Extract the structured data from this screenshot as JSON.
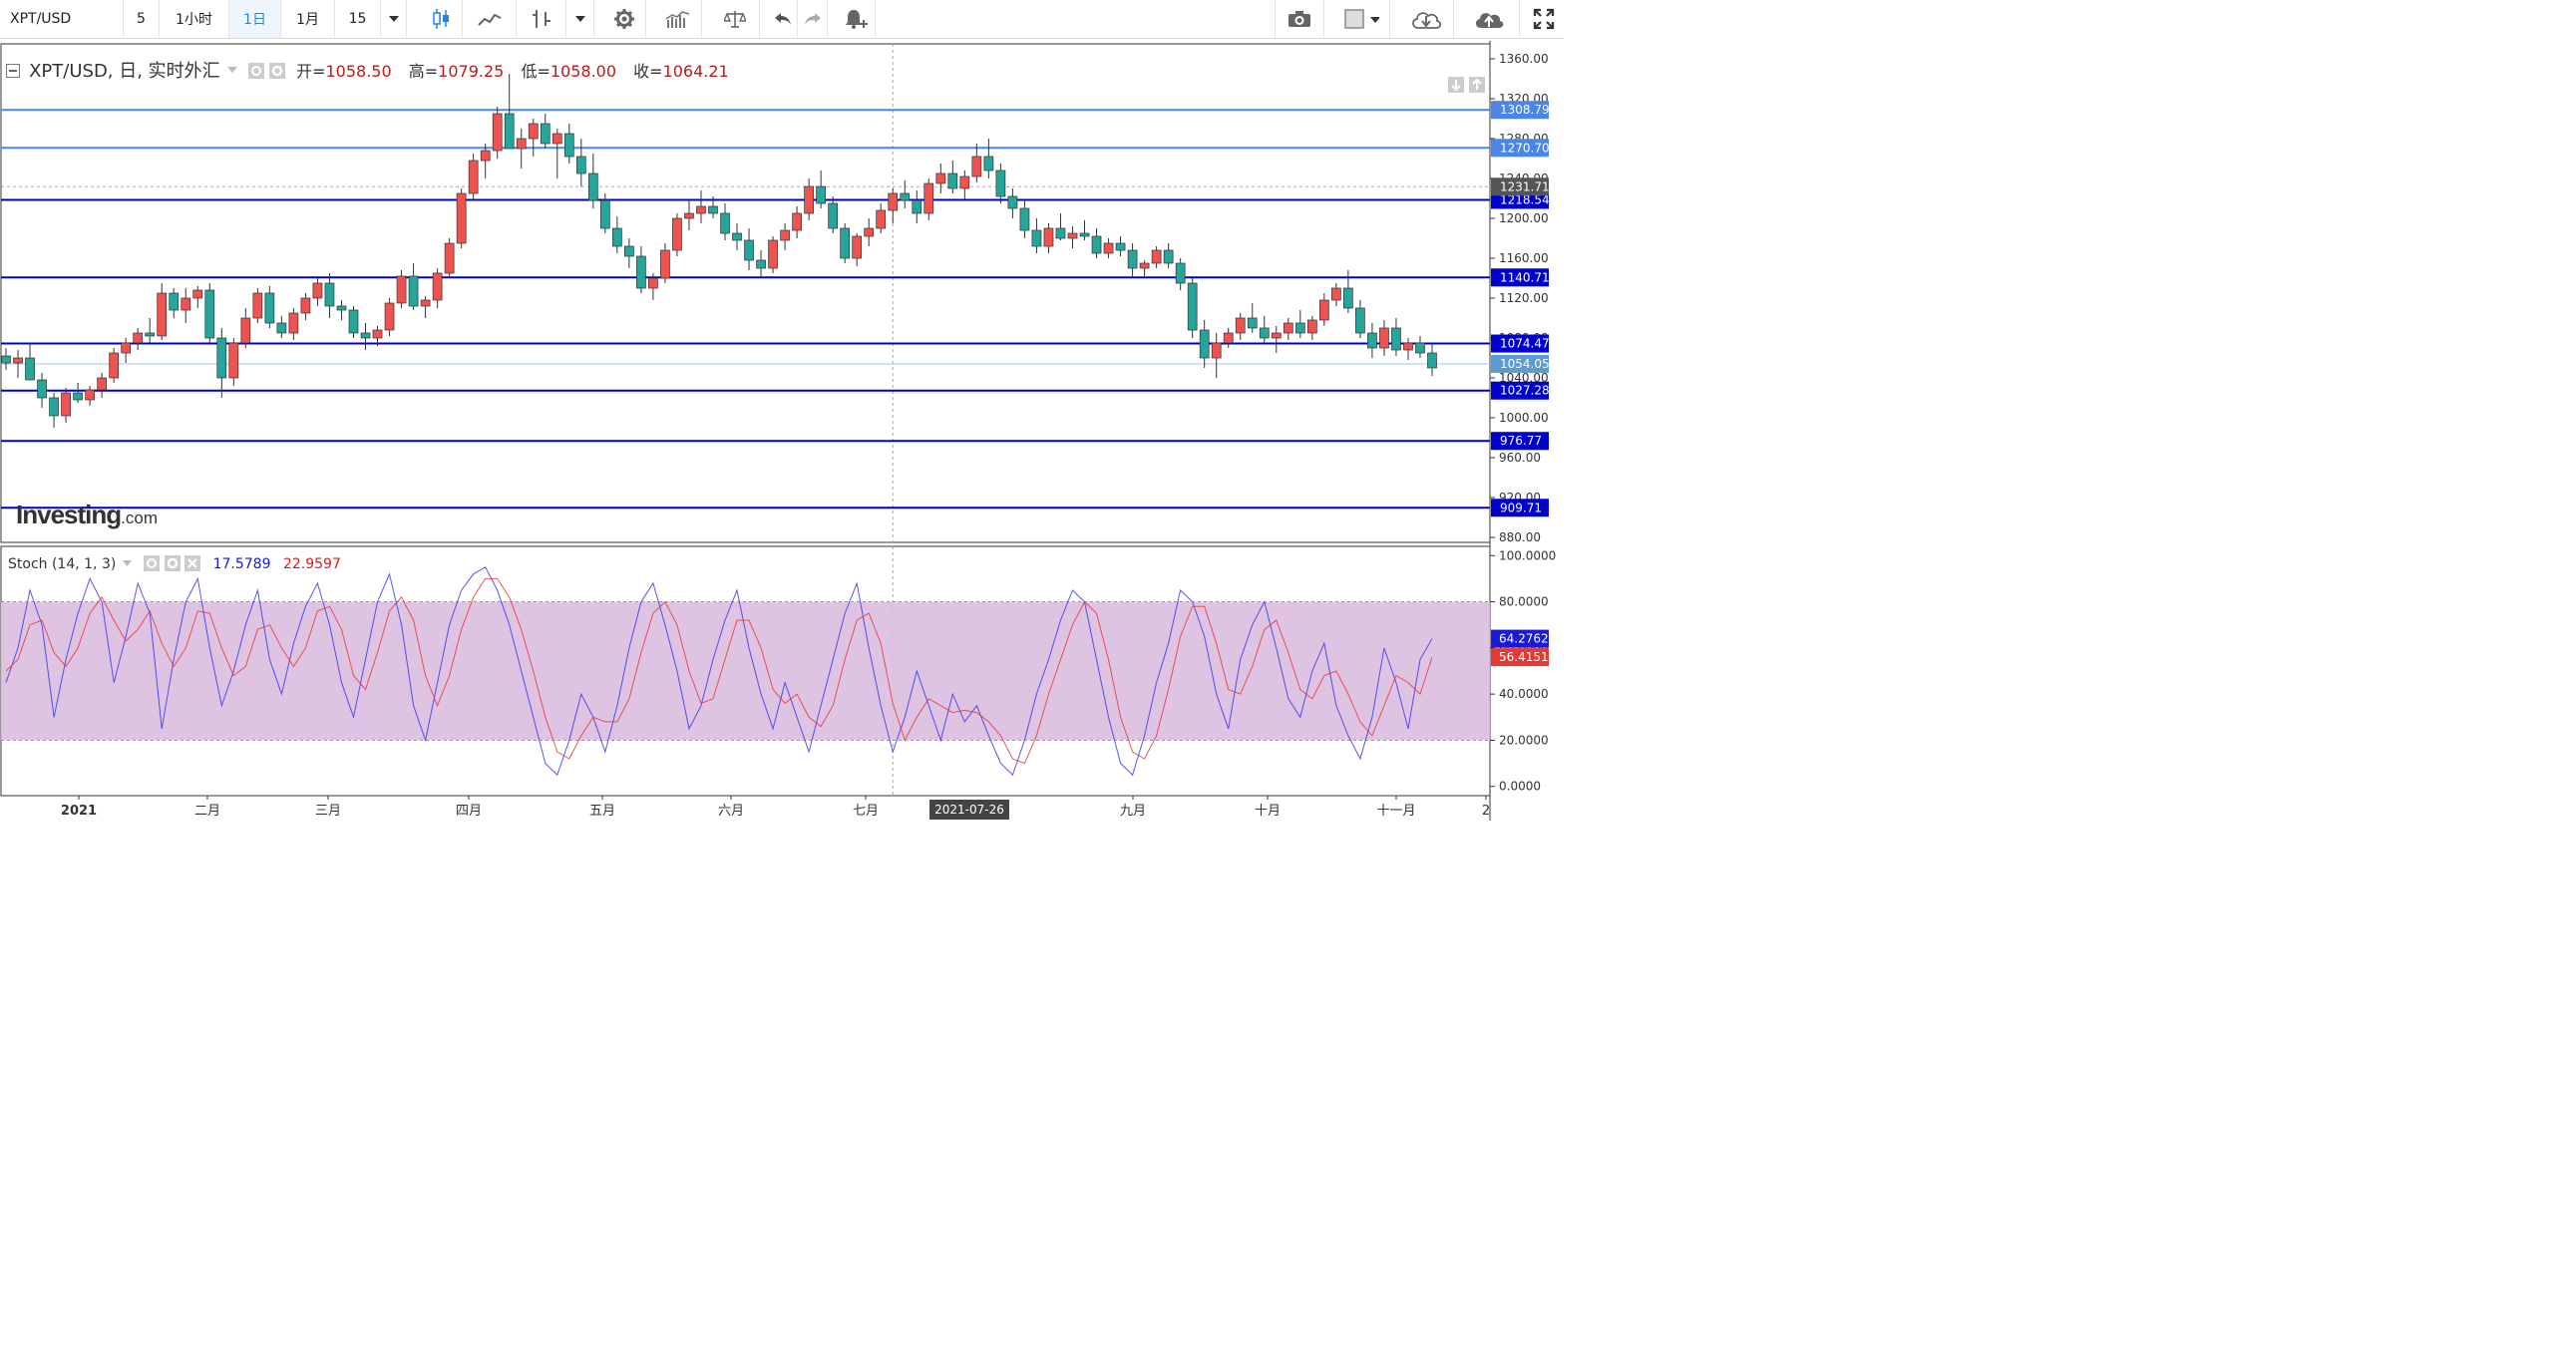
{
  "toolbar": {
    "symbol": "XPT/USD",
    "intervals": [
      "5",
      "1小时",
      "1日",
      "1月",
      "15"
    ],
    "active_interval": "1日"
  },
  "legend": {
    "title": "XPT/USD, 日, 实时外汇",
    "open_label": "开=",
    "open": "1058.50",
    "high_label": "高=",
    "high": "1079.25",
    "low_label": "低=",
    "low": "1058.00",
    "close_label": "收=",
    "close": "1064.21"
  },
  "stoch_legend": {
    "title": "Stoch (14, 1, 3)",
    "k_value": "17.5789",
    "d_value": "22.9597"
  },
  "watermark": {
    "brand": "Investing",
    "suffix": ".com"
  },
  "colors": {
    "up": "#ef5350",
    "down": "#26a69a",
    "level": "#0000cc",
    "level_light": "#4a86e8",
    "stoch_k": "#3a3ae8",
    "stoch_d": "#e83a3a",
    "stoch_band": "#dcbce0"
  },
  "chart_data": [
    {
      "type": "candlestick",
      "title": "XPT/USD",
      "y_ticks": [
        "880.00",
        "920.00",
        "960.00",
        "1000.00",
        "1040.00",
        "1080.00",
        "1120.00",
        "1160.00",
        "1200.00",
        "1240.00",
        "1280.00",
        "1320.00",
        "1360.00"
      ],
      "ylim": [
        875,
        1375
      ],
      "x_ticks": [
        "2021",
        "二月",
        "三月",
        "四月",
        "五月",
        "六月",
        "七月",
        "2021-07-26",
        "九月",
        "十月",
        "十一月",
        "2"
      ],
      "crosshair_date": "2021-07-26",
      "horizontal_levels": [
        1308.79,
        1270.7,
        1218.54,
        1140.71,
        1074.47,
        1027.28,
        976.77,
        909.71
      ],
      "level_labels": [
        "1308.79",
        "1270.70",
        "1218.54",
        "1140.71",
        "1074.47",
        "1027.28",
        "976.77",
        "909.71"
      ],
      "last_price": 1054.05,
      "last_price_label": "1054.05",
      "crosshair_price": 1231.71,
      "crosshair_price_label": "1231.71",
      "candles": [
        [
          1062,
          1070,
          1048,
          1055
        ],
        [
          1055,
          1068,
          1040,
          1060
        ],
        [
          1060,
          1075,
          1050,
          1038
        ],
        [
          1038,
          1045,
          1010,
          1020
        ],
        [
          1020,
          1025,
          990,
          1002
        ],
        [
          1002,
          1030,
          995,
          1025
        ],
        [
          1025,
          1035,
          1015,
          1018
        ],
        [
          1018,
          1032,
          1012,
          1028
        ],
        [
          1028,
          1045,
          1020,
          1040
        ],
        [
          1040,
          1070,
          1035,
          1065
        ],
        [
          1065,
          1080,
          1055,
          1075
        ],
        [
          1075,
          1090,
          1068,
          1085
        ],
        [
          1085,
          1100,
          1075,
          1082
        ],
        [
          1082,
          1135,
          1078,
          1125
        ],
        [
          1125,
          1130,
          1100,
          1108
        ],
        [
          1108,
          1130,
          1095,
          1120
        ],
        [
          1120,
          1132,
          1110,
          1128
        ],
        [
          1128,
          1135,
          1075,
          1080
        ],
        [
          1080,
          1090,
          1020,
          1040
        ],
        [
          1040,
          1080,
          1032,
          1075
        ],
        [
          1075,
          1110,
          1070,
          1100
        ],
        [
          1100,
          1130,
          1095,
          1125
        ],
        [
          1125,
          1132,
          1090,
          1095
        ],
        [
          1095,
          1102,
          1080,
          1085
        ],
        [
          1085,
          1110,
          1078,
          1105
        ],
        [
          1105,
          1125,
          1098,
          1120
        ],
        [
          1120,
          1140,
          1112,
          1135
        ],
        [
          1135,
          1145,
          1100,
          1112
        ],
        [
          1112,
          1118,
          1098,
          1108
        ],
        [
          1108,
          1112,
          1080,
          1085
        ],
        [
          1085,
          1095,
          1068,
          1080
        ],
        [
          1080,
          1092,
          1072,
          1088
        ],
        [
          1088,
          1120,
          1082,
          1115
        ],
        [
          1115,
          1148,
          1110,
          1142
        ],
        [
          1142,
          1155,
          1108,
          1112
        ],
        [
          1112,
          1122,
          1100,
          1118
        ],
        [
          1118,
          1150,
          1110,
          1145
        ],
        [
          1145,
          1180,
          1140,
          1175
        ],
        [
          1175,
          1230,
          1170,
          1225
        ],
        [
          1225,
          1265,
          1218,
          1258
        ],
        [
          1258,
          1275,
          1240,
          1268
        ],
        [
          1268,
          1312,
          1260,
          1305
        ],
        [
          1305,
          1345,
          1290,
          1270
        ],
        [
          1270,
          1290,
          1250,
          1280
        ],
        [
          1280,
          1300,
          1262,
          1295
        ],
        [
          1295,
          1305,
          1270,
          1275
        ],
        [
          1275,
          1290,
          1240,
          1285
        ],
        [
          1285,
          1295,
          1255,
          1262
        ],
        [
          1262,
          1280,
          1232,
          1245
        ],
        [
          1245,
          1265,
          1210,
          1218
        ],
        [
          1218,
          1225,
          1185,
          1190
        ],
        [
          1190,
          1202,
          1165,
          1172
        ],
        [
          1172,
          1180,
          1150,
          1162
        ],
        [
          1162,
          1172,
          1125,
          1130
        ],
        [
          1130,
          1145,
          1118,
          1140
        ],
        [
          1140,
          1175,
          1135,
          1168
        ],
        [
          1168,
          1205,
          1162,
          1200
        ],
        [
          1200,
          1218,
          1188,
          1205
        ],
        [
          1205,
          1228,
          1195,
          1212
        ],
        [
          1212,
          1222,
          1200,
          1205
        ],
        [
          1205,
          1215,
          1178,
          1185
        ],
        [
          1185,
          1195,
          1168,
          1178
        ],
        [
          1178,
          1190,
          1148,
          1158
        ],
        [
          1158,
          1168,
          1140,
          1150
        ],
        [
          1150,
          1182,
          1145,
          1178
        ],
        [
          1178,
          1195,
          1168,
          1188
        ],
        [
          1188,
          1212,
          1180,
          1205
        ],
        [
          1205,
          1240,
          1198,
          1232
        ],
        [
          1232,
          1248,
          1210,
          1215
        ],
        [
          1215,
          1222,
          1185,
          1190
        ],
        [
          1190,
          1195,
          1155,
          1160
        ],
        [
          1160,
          1185,
          1152,
          1182
        ],
        [
          1182,
          1200,
          1172,
          1190
        ],
        [
          1190,
          1215,
          1185,
          1208
        ],
        [
          1208,
          1230,
          1195,
          1225
        ],
        [
          1225,
          1238,
          1210,
          1218
        ],
        [
          1218,
          1228,
          1195,
          1205
        ],
        [
          1205,
          1240,
          1198,
          1235
        ],
        [
          1235,
          1255,
          1225,
          1245
        ],
        [
          1245,
          1258,
          1225,
          1230
        ],
        [
          1230,
          1248,
          1218,
          1242
        ],
        [
          1242,
          1275,
          1236,
          1262
        ],
        [
          1262,
          1280,
          1240,
          1248
        ],
        [
          1248,
          1255,
          1215,
          1222
        ],
        [
          1222,
          1230,
          1200,
          1210
        ],
        [
          1210,
          1218,
          1180,
          1188
        ],
        [
          1188,
          1200,
          1165,
          1172
        ],
        [
          1172,
          1195,
          1165,
          1190
        ],
        [
          1190,
          1205,
          1178,
          1180
        ],
        [
          1180,
          1192,
          1170,
          1185
        ],
        [
          1185,
          1198,
          1178,
          1182
        ],
        [
          1182,
          1190,
          1160,
          1165
        ],
        [
          1165,
          1180,
          1160,
          1175
        ],
        [
          1175,
          1182,
          1162,
          1168
        ],
        [
          1168,
          1175,
          1140,
          1150
        ],
        [
          1150,
          1158,
          1142,
          1155
        ],
        [
          1155,
          1172,
          1150,
          1168
        ],
        [
          1168,
          1175,
          1150,
          1155
        ],
        [
          1155,
          1160,
          1128,
          1135
        ],
        [
          1135,
          1140,
          1080,
          1088
        ],
        [
          1088,
          1098,
          1050,
          1060
        ],
        [
          1060,
          1085,
          1040,
          1075
        ],
        [
          1075,
          1090,
          1070,
          1085
        ],
        [
          1085,
          1105,
          1078,
          1100
        ],
        [
          1100,
          1115,
          1085,
          1090
        ],
        [
          1090,
          1102,
          1075,
          1080
        ],
        [
          1080,
          1092,
          1065,
          1085
        ],
        [
          1085,
          1100,
          1078,
          1095
        ],
        [
          1095,
          1108,
          1080,
          1085
        ],
        [
          1085,
          1102,
          1078,
          1098
        ],
        [
          1098,
          1125,
          1092,
          1118
        ],
        [
          1118,
          1135,
          1112,
          1130
        ],
        [
          1130,
          1148,
          1105,
          1110
        ],
        [
          1110,
          1118,
          1080,
          1085
        ],
        [
          1085,
          1095,
          1060,
          1070
        ],
        [
          1070,
          1098,
          1062,
          1090
        ],
        [
          1090,
          1100,
          1062,
          1068
        ],
        [
          1068,
          1080,
          1058,
          1075
        ],
        [
          1075,
          1082,
          1060,
          1065
        ],
        [
          1065,
          1075,
          1042,
          1050
        ]
      ]
    },
    {
      "type": "line",
      "title": "Stoch (14, 1, 3)",
      "y_ticks": [
        "0.0000",
        "20.0000",
        "40.0000",
        "60.0000",
        "80.0000",
        "100.0000"
      ],
      "ylim": [
        -4,
        104
      ],
      "band": [
        20,
        80
      ],
      "series": [
        {
          "name": "%K",
          "last_label": "64.2762",
          "values": [
            45,
            60,
            85,
            70,
            30,
            55,
            75,
            90,
            80,
            45,
            65,
            88,
            75,
            25,
            55,
            80,
            90,
            60,
            35,
            50,
            70,
            85,
            55,
            40,
            62,
            78,
            88,
            70,
            45,
            30,
            55,
            80,
            92,
            70,
            35,
            20,
            45,
            70,
            85,
            92,
            95,
            85,
            70,
            50,
            30,
            10,
            5,
            20,
            40,
            30,
            15,
            35,
            60,
            80,
            88,
            70,
            50,
            25,
            35,
            55,
            72,
            85,
            60,
            40,
            25,
            45,
            30,
            15,
            35,
            55,
            75,
            88,
            60,
            35,
            15,
            30,
            50,
            35,
            20,
            40,
            28,
            35,
            22,
            10,
            5,
            20,
            40,
            55,
            72,
            85,
            80,
            55,
            30,
            10,
            5,
            22,
            45,
            62,
            85,
            80,
            65,
            40,
            25,
            55,
            70,
            80,
            60,
            38,
            30,
            50,
            62,
            35,
            22,
            12,
            30,
            60,
            45,
            25,
            55,
            64
          ]
        },
        {
          "name": "%D",
          "last_label": "56.4151",
          "values": [
            50,
            55,
            70,
            72,
            58,
            52,
            60,
            75,
            82,
            72,
            63,
            68,
            76,
            62,
            52,
            60,
            76,
            75,
            60,
            48,
            52,
            68,
            70,
            60,
            52,
            60,
            76,
            78,
            68,
            48,
            42,
            58,
            76,
            82,
            72,
            48,
            35,
            48,
            68,
            82,
            90,
            90,
            82,
            68,
            50,
            30,
            15,
            12,
            22,
            30,
            28,
            28,
            38,
            58,
            75,
            80,
            70,
            50,
            36,
            38,
            55,
            72,
            72,
            60,
            42,
            36,
            40,
            30,
            26,
            35,
            55,
            72,
            75,
            62,
            36,
            20,
            30,
            38,
            35,
            32,
            33,
            32,
            28,
            22,
            12,
            10,
            22,
            40,
            55,
            70,
            80,
            75,
            55,
            30,
            15,
            12,
            22,
            42,
            65,
            78,
            78,
            62,
            42,
            40,
            52,
            68,
            72,
            58,
            42,
            38,
            48,
            50,
            40,
            28,
            22,
            35,
            48,
            45,
            40,
            56
          ]
        }
      ]
    }
  ]
}
